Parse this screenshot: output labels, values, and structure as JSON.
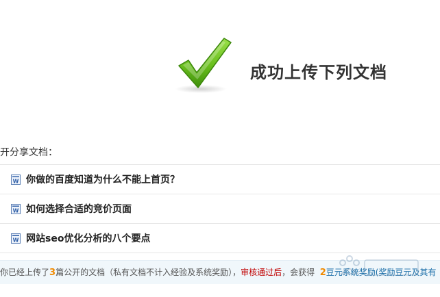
{
  "success": {
    "title": "成功上传下列文档"
  },
  "section": {
    "label": "开分享文档："
  },
  "documents": [
    {
      "title": "你做的百度知道为什么不能上首页？",
      "icon": "word-doc-icon"
    },
    {
      "title": "如何选择合适的竞价页面",
      "icon": "word-doc-icon"
    },
    {
      "title": "网站seo优化分析的八个要点",
      "icon": "word-doc-icon"
    }
  ],
  "status": {
    "prefix": "你已经上传了",
    "count": "3",
    "middle": "篇公开的文档（私有文档不计入经验及系统奖励），",
    "review": "审核通过后",
    "gain": "，会获得",
    "points": "2",
    "suffix": "豆元系统奖励(奖励豆元及其有"
  },
  "colors": {
    "check_green": "#6abf1e",
    "accent_orange": "#f08a00",
    "review_red": "#c00000",
    "status_bg": "#f0f7fb"
  }
}
